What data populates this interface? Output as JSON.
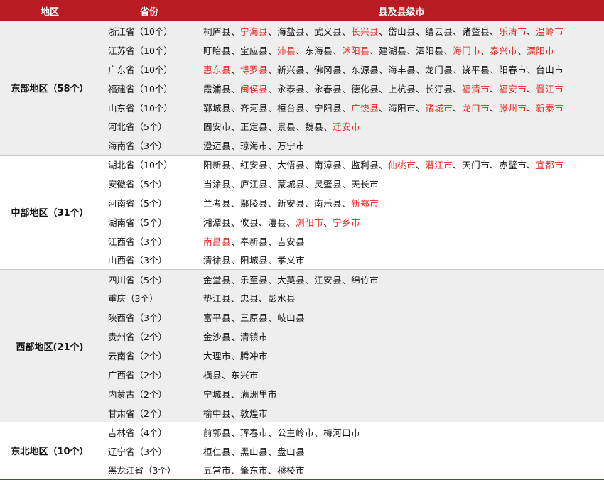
{
  "header": {
    "region": "地区",
    "province": "省份",
    "cities": "县及县级市"
  },
  "colors": {
    "header_bg": "#b81c22",
    "highlight": "#e8261f",
    "shade": "#eeeeee"
  },
  "groups": [
    {
      "region": "东部地区（58个）",
      "rows": [
        {
          "province": "浙江省（10个）",
          "cities": [
            {
              "name": "桐庐县",
              "hl": false
            },
            {
              "name": "宁海县",
              "hl": true
            },
            {
              "name": "海盐县",
              "hl": false
            },
            {
              "name": "武义县",
              "hl": false
            },
            {
              "name": "长兴县",
              "hl": true
            },
            {
              "name": "岱山县",
              "hl": false
            },
            {
              "name": "缙云县",
              "hl": false
            },
            {
              "name": "诸暨县",
              "hl": false
            },
            {
              "name": "乐清市",
              "hl": true
            },
            {
              "name": "温岭市",
              "hl": true
            }
          ]
        },
        {
          "province": "江苏省（10个）",
          "cities": [
            {
              "name": "盱眙县",
              "hl": false
            },
            {
              "name": "宝应县",
              "hl": false
            },
            {
              "name": "沛县",
              "hl": true
            },
            {
              "name": "东海县",
              "hl": false
            },
            {
              "name": "沭阳县",
              "hl": true
            },
            {
              "name": "建湖县",
              "hl": false
            },
            {
              "name": "泗阳县",
              "hl": false
            },
            {
              "name": "海门市",
              "hl": true
            },
            {
              "name": "泰兴市",
              "hl": true
            },
            {
              "name": "溧阳市",
              "hl": true
            }
          ]
        },
        {
          "province": "广东省（10个）",
          "cities": [
            {
              "name": "惠东县",
              "hl": true
            },
            {
              "name": "博罗县",
              "hl": true
            },
            {
              "name": "新兴县",
              "hl": false
            },
            {
              "name": "佛冈县",
              "hl": false
            },
            {
              "name": "东源县",
              "hl": false
            },
            {
              "name": "海丰县",
              "hl": false
            },
            {
              "name": "龙门县",
              "hl": false
            },
            {
              "name": "饶平县",
              "hl": false
            },
            {
              "name": "阳春市",
              "hl": false
            },
            {
              "name": "台山市",
              "hl": false
            }
          ]
        },
        {
          "province": "福建省（10个）",
          "cities": [
            {
              "name": "霞浦县",
              "hl": false
            },
            {
              "name": "闽侯县",
              "hl": true
            },
            {
              "name": "永泰县",
              "hl": false
            },
            {
              "name": "永春县",
              "hl": false
            },
            {
              "name": "德化县",
              "hl": false
            },
            {
              "name": "上杭县",
              "hl": false
            },
            {
              "name": "长汀县",
              "hl": false
            },
            {
              "name": "福清市",
              "hl": true
            },
            {
              "name": "福安市",
              "hl": true
            },
            {
              "name": "晋江市",
              "hl": true
            }
          ]
        },
        {
          "province": "山东省（10个）",
          "cities": [
            {
              "name": "郓城县",
              "hl": false
            },
            {
              "name": "齐河县",
              "hl": false
            },
            {
              "name": "桓台县",
              "hl": false
            },
            {
              "name": "宁阳县",
              "hl": false
            },
            {
              "name": "广饶县",
              "hl": true
            },
            {
              "name": "海阳市",
              "hl": false
            },
            {
              "name": "诸城市",
              "hl": true
            },
            {
              "name": "龙口市",
              "hl": true
            },
            {
              "name": "滕州市",
              "hl": true
            },
            {
              "name": "新泰市",
              "hl": true
            }
          ]
        },
        {
          "province": "河北省（5个）",
          "cities": [
            {
              "name": "固安市",
              "hl": false
            },
            {
              "name": "正定县",
              "hl": false
            },
            {
              "name": "景县",
              "hl": false
            },
            {
              "name": "魏县",
              "hl": false
            },
            {
              "name": "迁安市",
              "hl": true
            }
          ]
        },
        {
          "province": "海南省（3个）",
          "cities": [
            {
              "name": "澄迈县",
              "hl": false
            },
            {
              "name": "琼海市",
              "hl": false
            },
            {
              "name": "万宁市",
              "hl": false
            }
          ]
        }
      ]
    },
    {
      "region": "中部地区（31个）",
      "rows": [
        {
          "province": "湖北省（10个）",
          "cities": [
            {
              "name": "阳新县",
              "hl": false
            },
            {
              "name": "红安县",
              "hl": false
            },
            {
              "name": "大悟县",
              "hl": false
            },
            {
              "name": "南漳县",
              "hl": false
            },
            {
              "name": "监利县",
              "hl": false
            },
            {
              "name": "仙桃市",
              "hl": true
            },
            {
              "name": "潜江市",
              "hl": true
            },
            {
              "name": "天门市",
              "hl": false
            },
            {
              "name": "赤壁市",
              "hl": false
            },
            {
              "name": "宜都市",
              "hl": true
            }
          ]
        },
        {
          "province": "安徽省（5个）",
          "cities": [
            {
              "name": "当涂县",
              "hl": false
            },
            {
              "name": "庐江县",
              "hl": false
            },
            {
              "name": "蒙城县",
              "hl": false
            },
            {
              "name": "灵璧县",
              "hl": false
            },
            {
              "name": "天长市",
              "hl": false
            }
          ]
        },
        {
          "province": "河南省（5个）",
          "cities": [
            {
              "name": "兰考县",
              "hl": false
            },
            {
              "name": "鄢陵县",
              "hl": false
            },
            {
              "name": "新安县",
              "hl": false
            },
            {
              "name": "南乐县",
              "hl": false
            },
            {
              "name": "新郑市",
              "hl": true
            }
          ]
        },
        {
          "province": "湖南省（5个）",
          "cities": [
            {
              "name": "湘潭县",
              "hl": false
            },
            {
              "name": "攸县",
              "hl": false
            },
            {
              "name": "澧县",
              "hl": false
            },
            {
              "name": "浏阳市",
              "hl": true
            },
            {
              "name": "宁乡市",
              "hl": true
            }
          ]
        },
        {
          "province": "江西省（3个）",
          "cities": [
            {
              "name": "南昌县",
              "hl": true
            },
            {
              "name": "奉新县",
              "hl": false
            },
            {
              "name": "吉安县",
              "hl": false
            }
          ]
        },
        {
          "province": "山西省（3个）",
          "cities": [
            {
              "name": "清徐县",
              "hl": false
            },
            {
              "name": "阳城县",
              "hl": false
            },
            {
              "name": "孝义市",
              "hl": false
            }
          ]
        }
      ]
    },
    {
      "region": "西部地区(21个)",
      "rows": [
        {
          "province": "四川省（5个）",
          "cities": [
            {
              "name": "金堂县",
              "hl": false
            },
            {
              "name": "乐至县",
              "hl": false
            },
            {
              "name": "大英县",
              "hl": false
            },
            {
              "name": "江安县",
              "hl": false
            },
            {
              "name": "绵竹市",
              "hl": false
            }
          ]
        },
        {
          "province": "重庆（3个）",
          "cities": [
            {
              "name": "垫江县",
              "hl": false
            },
            {
              "name": "忠县",
              "hl": false
            },
            {
              "name": "彭水县",
              "hl": false
            }
          ]
        },
        {
          "province": "陕西省（3个）",
          "cities": [
            {
              "name": "富平县",
              "hl": false
            },
            {
              "name": "三原县",
              "hl": false
            },
            {
              "name": "岐山县",
              "hl": false
            }
          ]
        },
        {
          "province": "贵州省（2个）",
          "cities": [
            {
              "name": "金沙县",
              "hl": false
            },
            {
              "name": "清镇市",
              "hl": false
            }
          ]
        },
        {
          "province": "云南省（2个）",
          "cities": [
            {
              "name": "大理市",
              "hl": false
            },
            {
              "name": "腾冲市",
              "hl": false
            }
          ]
        },
        {
          "province": "广西省（2个）",
          "cities": [
            {
              "name": "横县",
              "hl": false
            },
            {
              "name": "东兴市",
              "hl": false
            }
          ]
        },
        {
          "province": "内蒙古（2个）",
          "cities": [
            {
              "name": "宁城县",
              "hl": false
            },
            {
              "name": "满洲里市",
              "hl": false
            }
          ]
        },
        {
          "province": "甘肃省（2个）",
          "cities": [
            {
              "name": "榆中县",
              "hl": false
            },
            {
              "name": "敦煌市",
              "hl": false
            }
          ]
        }
      ]
    },
    {
      "region": "东北地区（10个）",
      "rows": [
        {
          "province": "吉林省（4个）",
          "cities": [
            {
              "name": "前郭县",
              "hl": false
            },
            {
              "name": "珲春市",
              "hl": false
            },
            {
              "name": "公主岭市",
              "hl": false
            },
            {
              "name": "梅河口市",
              "hl": false
            }
          ]
        },
        {
          "province": "辽宁省（3个）",
          "cities": [
            {
              "name": "桓仁县",
              "hl": false
            },
            {
              "name": "黑山县",
              "hl": false
            },
            {
              "name": "盘山县",
              "hl": false
            }
          ]
        },
        {
          "province": "黑龙江省（3个）",
          "cities": [
            {
              "name": "五常市",
              "hl": false
            },
            {
              "name": "肇东市",
              "hl": false
            },
            {
              "name": "穆棱市",
              "hl": false
            }
          ]
        }
      ]
    }
  ]
}
